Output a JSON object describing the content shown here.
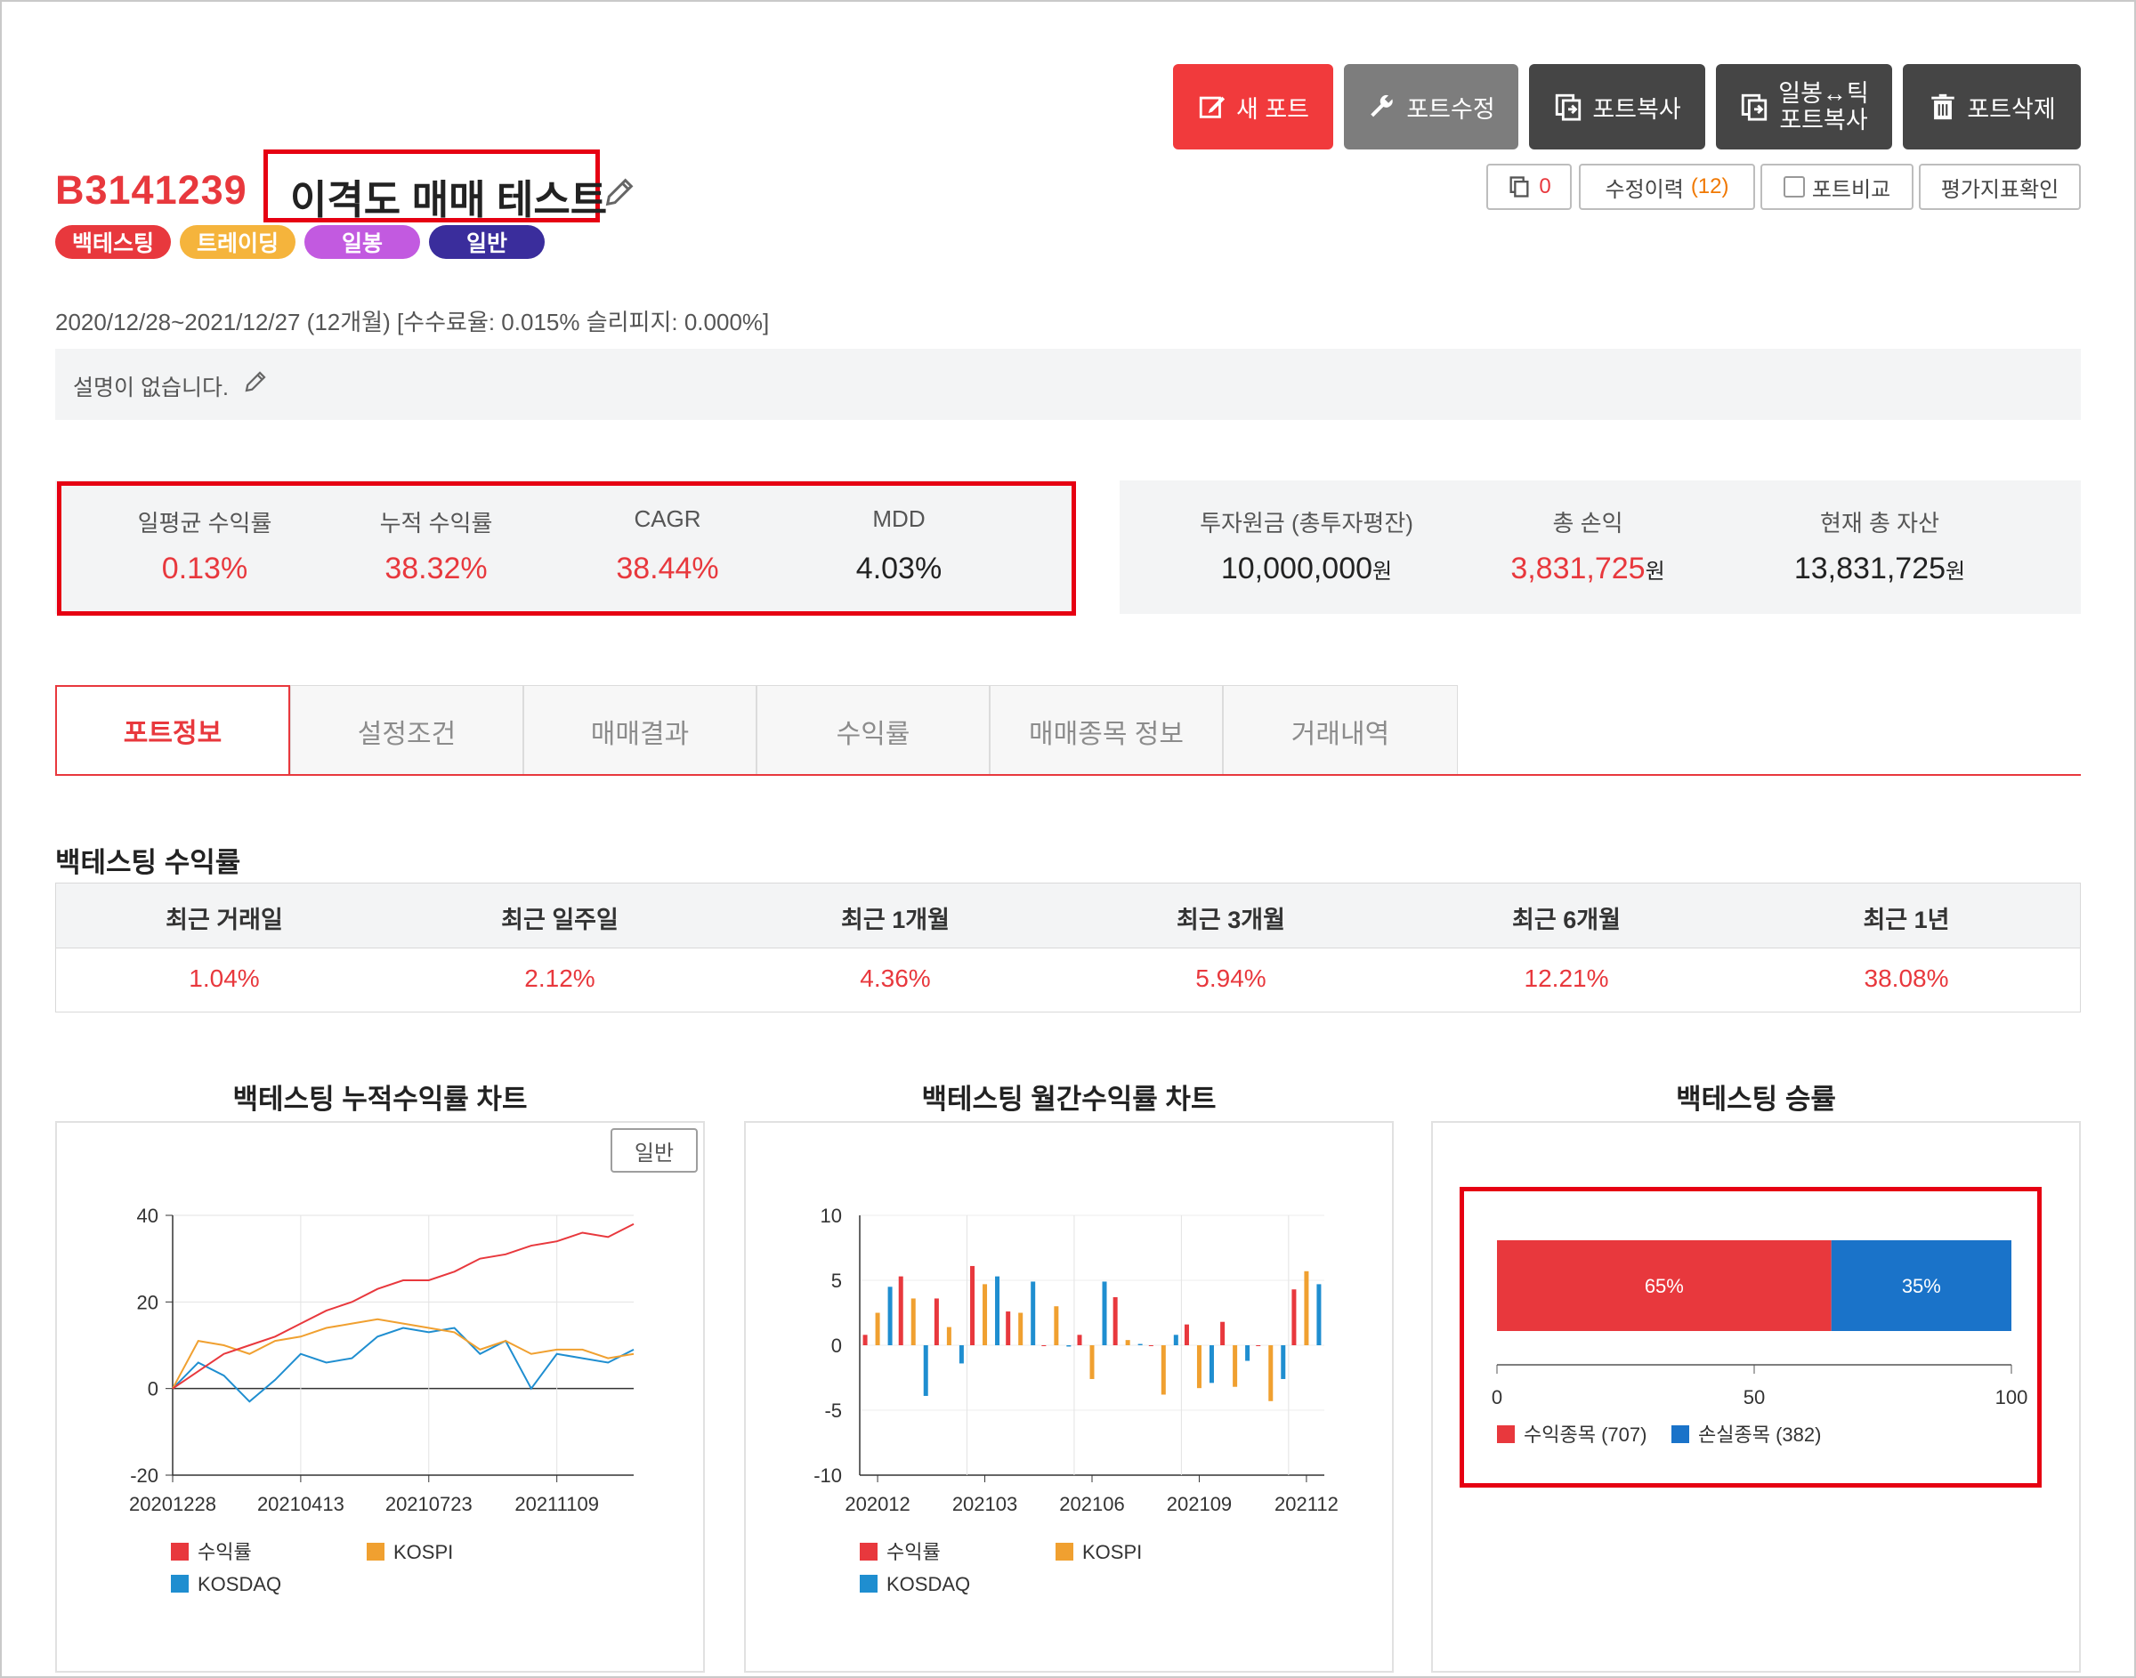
{
  "toolbar": {
    "new": "새 포트",
    "edit": "포트수정",
    "copy": "포트복사",
    "conv_line1": "일봉↔틱",
    "conv_line2": "포트복사",
    "delete": "포트삭제"
  },
  "subbar": {
    "copy_count": "0",
    "history_label": "수정이력",
    "history_count": "(12)",
    "compare": "포트비교",
    "evaluate": "평가지표확인"
  },
  "port": {
    "code": "B3141239",
    "title": "이격도 매매 테스트",
    "tags": [
      "백테스팅",
      "트레이딩",
      "일봉",
      "일반"
    ],
    "period": "2020/12/28~2021/12/27 (12개월) [수수료율: 0.015% 슬리피지: 0.000%]",
    "description": "설명이 없습니다."
  },
  "stats": {
    "daily_avg_label": "일평균 수익률",
    "daily_avg": "0.13%",
    "cum_label": "누적 수익률",
    "cum": "38.32%",
    "cagr_label": "CAGR",
    "cagr": "38.44%",
    "mdd_label": "MDD",
    "mdd": "4.03%",
    "principal_label": "투자원금 (총투자평잔)",
    "principal": "10,000,000",
    "pnl_label": "총 손익",
    "pnl": "3,831,725",
    "asset_label": "현재 총 자산",
    "asset": "13,831,725",
    "won": "원"
  },
  "tabs": [
    "포트정보",
    "설정조건",
    "매매결과",
    "수익률",
    "매매종목 정보",
    "거래내역"
  ],
  "returns": {
    "title": "백테스팅 수익률",
    "headers": [
      "최근 거래일",
      "최근 일주일",
      "최근 1개월",
      "최근 3개월",
      "최근 6개월",
      "최근 1년"
    ],
    "values": [
      "1.04%",
      "2.12%",
      "4.36%",
      "5.94%",
      "12.21%",
      "38.08%"
    ]
  },
  "charts": {
    "cum_title": "백테스팅 누적수익률 차트",
    "monthly_title": "백테스팅 월간수익률 차트",
    "win_title": "백테스팅 승률",
    "mode_button": "일반"
  },
  "colors": {
    "accent": "#e8383d",
    "kospi": "#f0a030",
    "kosdaq": "#1f8ed0",
    "loss": "#1a73c9"
  },
  "chart_data": [
    {
      "type": "line",
      "title": "백테스팅 누적수익률 차트",
      "x_ticks": [
        "20201228",
        "20210413",
        "20210723",
        "20211109"
      ],
      "ylim": [
        -20,
        40
      ],
      "y_ticks": [
        40,
        20,
        0,
        -20
      ],
      "grid": true,
      "legend": "bottom",
      "x": [
        "20201228",
        "20210118",
        "20210208",
        "20210301",
        "20210322",
        "20210413",
        "20210503",
        "20210524",
        "20210614",
        "20210705",
        "20210723",
        "20210813",
        "20210903",
        "20210924",
        "20211015",
        "20211109",
        "20211130",
        "20211220",
        "20211227"
      ],
      "series": [
        {
          "name": "수익률",
          "values": [
            0,
            4,
            8,
            10,
            12,
            15,
            18,
            20,
            23,
            25,
            25,
            27,
            30,
            31,
            33,
            34,
            36,
            35,
            38
          ]
        },
        {
          "name": "KOSPI",
          "values": [
            0,
            11,
            10,
            8,
            11,
            12,
            14,
            15,
            16,
            15,
            14,
            13,
            9,
            11,
            8,
            9,
            9,
            7,
            8
          ]
        },
        {
          "name": "KOSDAQ",
          "values": [
            0,
            6,
            3,
            -3,
            2,
            8,
            6,
            7,
            12,
            14,
            13,
            14,
            8,
            11,
            0,
            8,
            7,
            6,
            9
          ]
        }
      ]
    },
    {
      "type": "bar",
      "title": "백테스팅 월간수익률 차트",
      "x_ticks": [
        "202012",
        "202103",
        "202106",
        "202109",
        "202112"
      ],
      "categories": [
        "202012",
        "202101",
        "202102",
        "202103",
        "202104",
        "202105",
        "202106",
        "202107",
        "202108",
        "202109",
        "202110",
        "202111",
        "202112"
      ],
      "ylim": [
        -10,
        10
      ],
      "y_ticks": [
        10,
        5,
        0,
        -5,
        -10
      ],
      "grid": true,
      "legend": "bottom",
      "series": [
        {
          "name": "수익률",
          "values": [
            0.8,
            5.3,
            3.6,
            6.1,
            2.6,
            0.0,
            0.8,
            3.7,
            0.0,
            1.6,
            1.8,
            0.0,
            4.3
          ]
        },
        {
          "name": "KOSPI",
          "values": [
            2.5,
            3.6,
            1.4,
            4.7,
            2.5,
            3.0,
            -2.6,
            0.4,
            -3.8,
            -3.3,
            -3.2,
            -4.3,
            5.7
          ]
        },
        {
          "name": "KOSDAQ",
          "values": [
            4.5,
            -3.9,
            -1.4,
            5.3,
            4.9,
            -0.1,
            4.9,
            0.1,
            0.8,
            -2.9,
            -1.2,
            -2.6,
            4.7
          ]
        }
      ]
    },
    {
      "type": "bar",
      "title": "백테스팅 승률",
      "orientation": "horizontal-stacked",
      "xlim": [
        0,
        100
      ],
      "x_ticks": [
        0,
        50,
        100
      ],
      "legend": "bottom",
      "series": [
        {
          "name": "수익종목 (707)",
          "value": 65,
          "label": "65%"
        },
        {
          "name": "손실종목 (382)",
          "value": 35,
          "label": "35%"
        }
      ]
    }
  ]
}
